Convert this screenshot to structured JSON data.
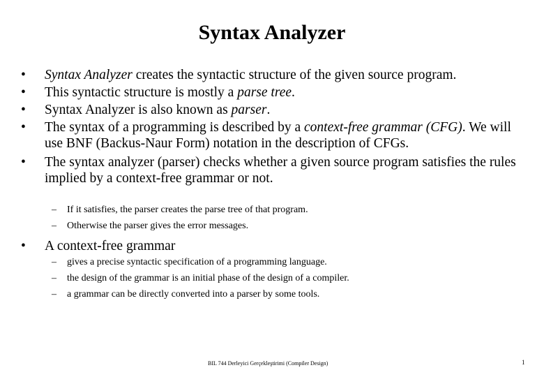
{
  "slide": {
    "title": "Syntax Analyzer",
    "bullets": [
      {
        "bullet": "•",
        "parts": {
          "a": "Syntax Analyzer",
          "b": " creates the syntactic structure of the given source program."
        }
      },
      {
        "bullet": "•",
        "parts": {
          "a": "This syntactic structure is mostly a ",
          "b": "parse tree",
          "c": "."
        }
      },
      {
        "bullet": "•",
        "parts": {
          "a": "Syntax Analyzer is also known as ",
          "b": "parser",
          "c": "."
        }
      },
      {
        "bullet": "•",
        "parts": {
          "a": "The syntax of a programming is described by a ",
          "b": "context-free grammar (CFG)",
          "c": ". We will",
          "d": "use BNF (Backus-Naur Form) notation in the description of CFGs."
        }
      },
      {
        "bullet": "•",
        "parts": {
          "a": "The syntax analyzer (parser) checks whether a given source program satisfies the rules",
          "b": "implied by a context-free grammar or not."
        },
        "subitems": [
          {
            "dash": "–",
            "text": "If it satisfies, the parser creates the parse tree of that program."
          },
          {
            "dash": "–",
            "text": "Otherwise the parser gives the error messages."
          }
        ]
      },
      {
        "bullet": "•",
        "parts": {
          "a": "A context-free grammar"
        },
        "subitems": [
          {
            "dash": "–",
            "text": "gives a precise syntactic specification of a programming language."
          },
          {
            "dash": "–",
            "text": "the design of the grammar is an initial phase of the design of a compiler."
          },
          {
            "dash": "–",
            "text": "a grammar can be directly  converted into a parser by some tools."
          }
        ]
      }
    ],
    "footer": "BIL 744 Derleyici Gerçekleştirimi (Compiler Design)",
    "page_number": "1"
  }
}
